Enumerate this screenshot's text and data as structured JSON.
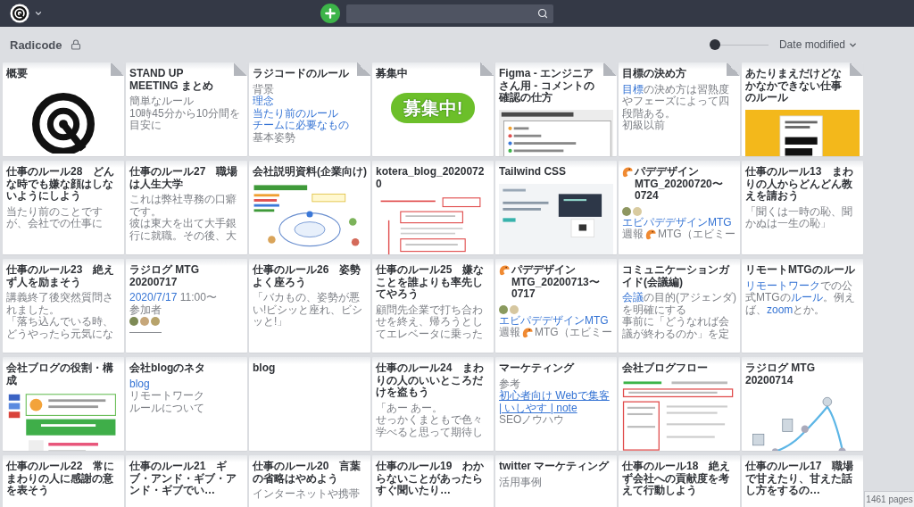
{
  "header": {
    "title": "Radicode",
    "locked": true,
    "zoom": {
      "level": 0
    },
    "sort": {
      "label": "Date modified"
    }
  },
  "cards": [
    {
      "title": "概要",
      "folded_corner": true,
      "title_emoji": false,
      "body": [
        {
          "kind": "logo"
        }
      ]
    },
    {
      "title": "STAND UP MEETING まとめ",
      "folded_corner": true,
      "title_emoji": false,
      "body": [
        {
          "kind": "text",
          "text": "簡単なルール"
        },
        {
          "kind": "text",
          "text": "10時45分から10分間を目安に"
        }
      ]
    },
    {
      "title": "ラジコードのルール",
      "folded_corner": true,
      "title_emoji": false,
      "body": [
        {
          "kind": "text",
          "text": "背景"
        },
        {
          "kind": "link",
          "text": "理念",
          "underlined": false
        },
        {
          "kind": "link",
          "text": "当たり前のルール",
          "underlined": false
        },
        {
          "kind": "link",
          "text": "チームに必要なもの",
          "underlined": false
        },
        {
          "kind": "text",
          "text": "基本姿勢"
        }
      ]
    },
    {
      "title": "募集中",
      "folded_corner": true,
      "title_emoji": false,
      "body": [
        {
          "kind": "banner",
          "text": "募集中!"
        }
      ]
    },
    {
      "title": "Figma - エンジニアさん用 - コメントの確認の仕方",
      "folded_corner": true,
      "title_emoji": false,
      "body": [
        {
          "kind": "document"
        }
      ]
    },
    {
      "title": "目標の決め方",
      "folded_corner": true,
      "title_emoji": false,
      "body": [
        {
          "kind": "mixed",
          "segments": [
            {
              "kind": "link",
              "text": "目標",
              "underlined": false
            },
            {
              "kind": "plain",
              "text": "の決め方は習熟度やフェーズによって四段階ある。"
            }
          ]
        },
        {
          "kind": "text",
          "text": "初級以前"
        }
      ]
    },
    {
      "title": "あたりまえだけどなかなかできない仕事のルール",
      "folded_corner": true,
      "title_emoji": false,
      "body": [
        {
          "kind": "book"
        }
      ]
    },
    {
      "title": "仕事のルール28　どんな時でも嫌な顔はしないようにしよう",
      "folded_corner": false,
      "title_emoji": false,
      "body": [
        {
          "kind": "text",
          "text": "当たり前のことですが、会社での仕事に"
        }
      ]
    },
    {
      "title": "仕事のルール27　職場は人生大学",
      "folded_corner": false,
      "title_emoji": false,
      "body": [
        {
          "kind": "text",
          "text": "これは弊社専務の口癖です。"
        },
        {
          "kind": "text",
          "text": "彼は東大を出て大手銀行に就職。その後、大"
        }
      ]
    },
    {
      "title": "会社説明資料(企業向け)",
      "folded_corner": false,
      "title_emoji": false,
      "body": [
        {
          "kind": "diagram"
        }
      ]
    },
    {
      "title": "kotera_blog_20200720",
      "folded_corner": false,
      "title_emoji": false,
      "body": [
        {
          "kind": "markup"
        }
      ]
    },
    {
      "title": "Tailwind CSS",
      "folded_corner": false,
      "title_emoji": false,
      "body": [
        {
          "kind": "webpage"
        }
      ]
    },
    {
      "title": "パデデザインMTG_20200720〜0724",
      "folded_corner": false,
      "title_emoji": true,
      "body": [
        {
          "kind": "avatars",
          "avatars": [
            {
              "color": "#8e9660"
            },
            {
              "color": "#d9cba0"
            }
          ]
        },
        {
          "kind": "link",
          "text": "エビパデデザインMTG",
          "underlined": false
        },
        {
          "kind": "mixed",
          "segments": [
            {
              "kind": "plain",
              "text": "週報"
            },
            {
              "kind": "emoji"
            },
            {
              "kind": "plain",
              "text": "MTG（エビミー"
            }
          ]
        }
      ]
    },
    {
      "title": "仕事のルール13　まわりの人からどんどん教えを請おう",
      "folded_corner": false,
      "title_emoji": false,
      "body": [
        {
          "kind": "text",
          "text": "「聞くは一時の恥、聞かぬは一生の恥」"
        }
      ]
    },
    {
      "title": "仕事のルール23　絶えず人を励まそう",
      "folded_corner": false,
      "title_emoji": false,
      "body": [
        {
          "kind": "text",
          "text": "講義終了後突然質問されました。"
        },
        {
          "kind": "text",
          "text": "「落ち込んでいる時、どうやったら元気にな"
        }
      ]
    },
    {
      "title": "ラジログ MTG 20200717",
      "folded_corner": false,
      "title_emoji": false,
      "body": [
        {
          "kind": "mixed",
          "segments": [
            {
              "kind": "link",
              "text": "2020/7/17",
              "underlined": false
            },
            {
              "kind": "plain",
              "text": " 11:00〜"
            }
          ]
        },
        {
          "kind": "text",
          "text": "参加者"
        },
        {
          "kind": "avatars",
          "avatars": [
            {
              "color": "#7d8a55"
            },
            {
              "color": "#c6a77a"
            },
            {
              "color": "#b7a36b"
            }
          ]
        },
        {
          "kind": "text",
          "text": "———"
        }
      ]
    },
    {
      "title": "仕事のルール26　姿勢よく座ろう",
      "folded_corner": false,
      "title_emoji": false,
      "body": [
        {
          "kind": "text",
          "text": "「バカもの、姿勢が悪い!ビシッと座れ、ビシッと!」"
        }
      ]
    },
    {
      "title": "仕事のルール25　嫌なことを誰よりも率先してやろう",
      "folded_corner": false,
      "title_emoji": false,
      "body": [
        {
          "kind": "text",
          "text": "顧問先企業で打ち合わせを終え、帰ろうとしてエレベータに乗った"
        }
      ]
    },
    {
      "title": "パデデザインMTG_20200713〜0717",
      "folded_corner": false,
      "title_emoji": true,
      "body": [
        {
          "kind": "avatars",
          "avatars": [
            {
              "color": "#8a9a5e"
            },
            {
              "color": "#d6c7a0"
            }
          ]
        },
        {
          "kind": "link",
          "text": "エビパデデザインMTG",
          "underlined": false
        },
        {
          "kind": "mixed",
          "segments": [
            {
              "kind": "plain",
              "text": "週報"
            },
            {
              "kind": "emoji"
            },
            {
              "kind": "plain",
              "text": "MTG（エビミー"
            }
          ]
        }
      ]
    },
    {
      "title": "コミュニケーションガイド(会議編)",
      "folded_corner": false,
      "title_emoji": false,
      "body": [
        {
          "kind": "mixed",
          "segments": [
            {
              "kind": "link",
              "text": "会議",
              "underlined": false
            },
            {
              "kind": "plain",
              "text": "の目的(アジェンダ)を明確にする"
            }
          ]
        },
        {
          "kind": "text",
          "text": "事前に「どうなれば会議が終わるのか」を定"
        }
      ]
    },
    {
      "title": "リモートMTGのルール",
      "folded_corner": false,
      "title_emoji": false,
      "body": [
        {
          "kind": "mixed",
          "segments": [
            {
              "kind": "link",
              "text": "リモートワーク",
              "underlined": false
            },
            {
              "kind": "plain",
              "text": "での公式MTGの"
            },
            {
              "kind": "link",
              "text": "ルール",
              "underlined": false
            },
            {
              "kind": "plain",
              "text": "。例えば、"
            },
            {
              "kind": "link",
              "text": "zoom",
              "underlined": false
            },
            {
              "kind": "plain",
              "text": "とか。"
            }
          ]
        }
      ]
    },
    {
      "title": "会社ブログの役割・構成",
      "folded_corner": false,
      "title_emoji": false,
      "body": [
        {
          "kind": "slide"
        }
      ]
    },
    {
      "title": "会社blogのネタ",
      "folded_corner": false,
      "title_emoji": false,
      "body": [
        {
          "kind": "link",
          "text": "blog",
          "underlined": false
        },
        {
          "kind": "text",
          "text": "リモートワーク"
        },
        {
          "kind": "text",
          "text": "ルールについて"
        }
      ]
    },
    {
      "title": "blog",
      "folded_corner": false,
      "title_emoji": false
    },
    {
      "title": "仕事のルール24　まわりの人のいいところだけを盗もう",
      "folded_corner": false,
      "title_emoji": false,
      "body": [
        {
          "kind": "text",
          "text": "「あー あー。"
        },
        {
          "kind": "text",
          "text": "せっかくまともで色々学べると思って期待し"
        }
      ]
    },
    {
      "title": "マーケティング",
      "folded_corner": false,
      "title_emoji": false,
      "body": [
        {
          "kind": "text",
          "text": "参考"
        },
        {
          "kind": "link",
          "text": "初心者向け Webで集客 | いしやす | note",
          "underlined": true
        },
        {
          "kind": "text",
          "text": "SEOノウハウ"
        }
      ]
    },
    {
      "title": "会社ブログフロー",
      "folded_corner": false,
      "title_emoji": false,
      "body": [
        {
          "kind": "report"
        }
      ]
    },
    {
      "title": "ラジログ MTG 20200714",
      "folded_corner": false,
      "title_emoji": false,
      "body": [
        {
          "kind": "sketch"
        }
      ]
    },
    {
      "title": "仕事のルール22　常にまわりの人に感謝の意を表そう",
      "folded_corner": false,
      "title_emoji": false
    },
    {
      "title": "仕事のルール21　ギブ・アンド・ギブ・アンド・ギブでい…",
      "folded_corner": false,
      "title_emoji": false
    },
    {
      "title": "仕事のルール20　言葉の省略はやめよう",
      "folded_corner": false,
      "title_emoji": false,
      "body": [
        {
          "kind": "text",
          "text": "インターネットや携帯"
        }
      ]
    },
    {
      "title": "仕事のルール19　わからないことがあったらすぐ聞いたり…",
      "folded_corner": false,
      "title_emoji": false
    },
    {
      "title": "twitter マーケティング",
      "folded_corner": false,
      "title_emoji": false,
      "body": [
        {
          "kind": "text",
          "text": "活用事例"
        }
      ]
    },
    {
      "title": "仕事のルール18　絶えず会社への貢献度を考えて行動しよう",
      "folded_corner": false,
      "title_emoji": false
    },
    {
      "title": "仕事のルール17　職場で甘えたり、甘えた話し方をするの…",
      "folded_corner": false,
      "title_emoji": false
    }
  ],
  "page_count": "1461 pages"
}
